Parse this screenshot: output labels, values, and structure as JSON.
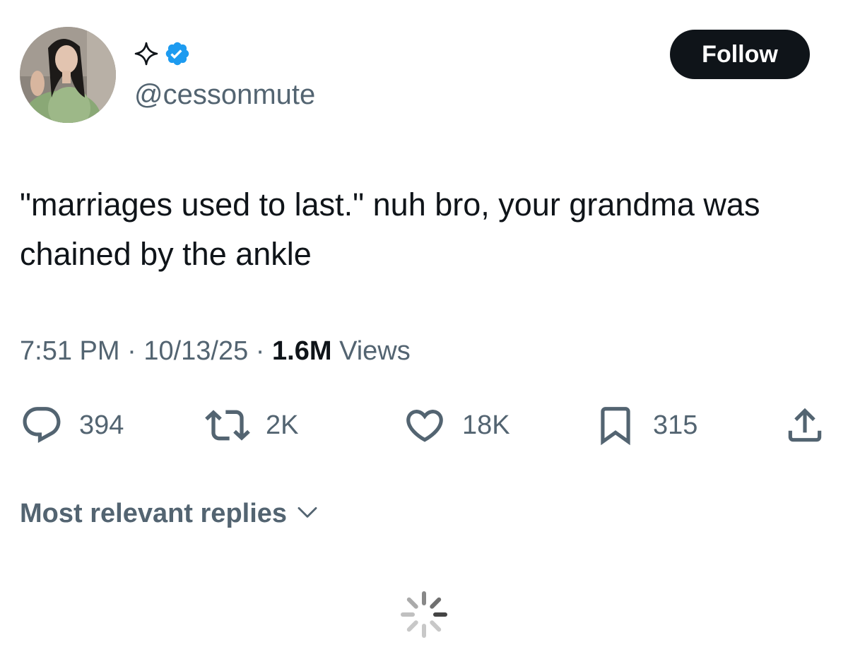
{
  "profile": {
    "display_name_icon": "four-point-sparkle-icon",
    "verified_icon": "verified-badge-icon",
    "verified_color": "#1d9bf0",
    "handle": "@cessonmute",
    "avatar": "profile-photo"
  },
  "follow_button": {
    "label": "Follow"
  },
  "tweet": {
    "text": "\"marriages used to last.\" nuh bro, your grandma was chained by the ankle",
    "time": "7:51 PM",
    "separator": "·",
    "date": "10/13/25",
    "views_count": "1.6M",
    "views_label": "Views"
  },
  "actions": {
    "reply": {
      "icon": "reply-icon",
      "count": "394"
    },
    "repost": {
      "icon": "repost-icon",
      "count": "2K"
    },
    "like": {
      "icon": "heart-icon",
      "count": "18K"
    },
    "bookmark": {
      "icon": "bookmark-icon",
      "count": "315"
    },
    "share": {
      "icon": "share-icon"
    }
  },
  "replies": {
    "sort_label": "Most relevant replies",
    "sort_icon": "chevron-down-icon"
  },
  "loading": {
    "icon": "loading-spinner-icon"
  }
}
